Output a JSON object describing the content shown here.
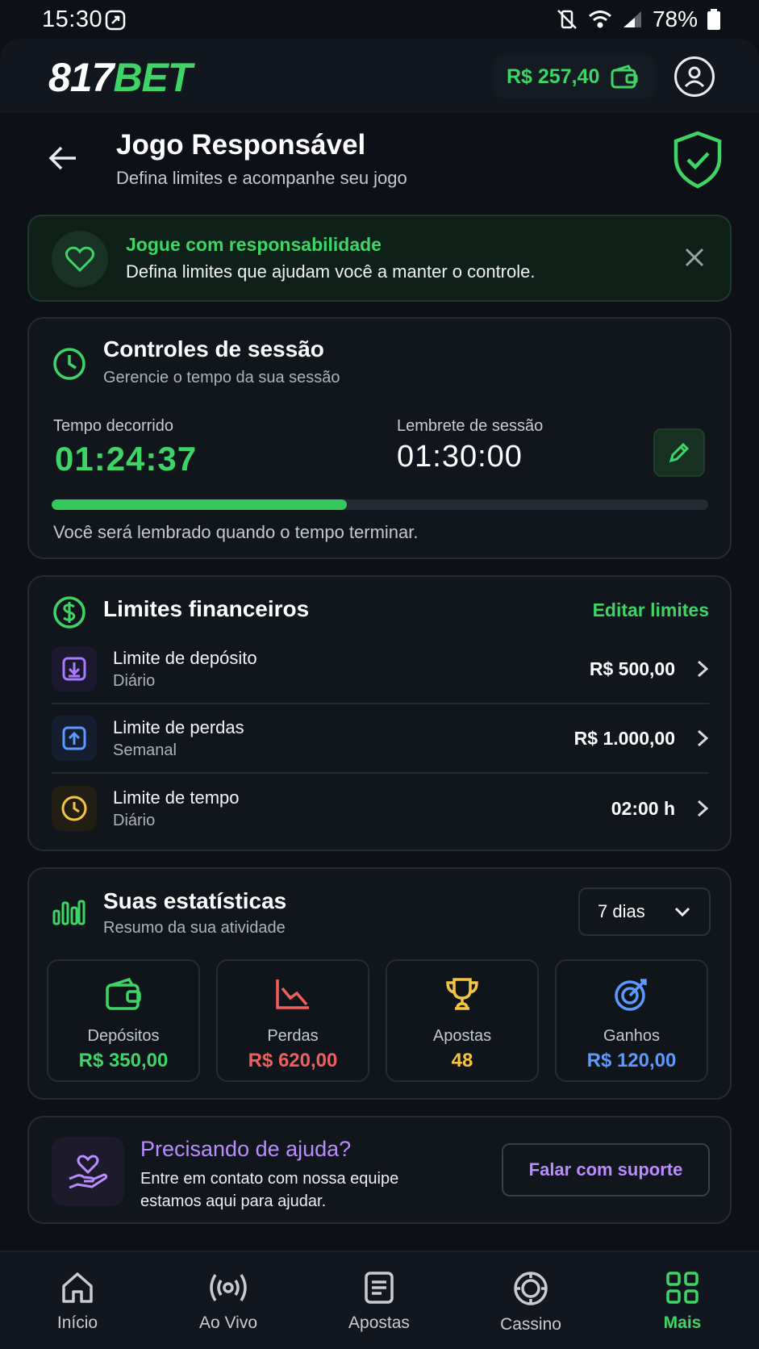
{
  "status_bar": {
    "time": "15:30",
    "battery": "78%"
  },
  "header": {
    "logo_white": "817",
    "logo_green": "BET",
    "balance": "R$ 257,40"
  },
  "page": {
    "title": "Jogo Responsável",
    "subtitle": "Defina limites e acompanhe seu jogo"
  },
  "banner": {
    "title": "Jogue com responsabilidade",
    "text": "Defina limites que ajudam você a manter o controle."
  },
  "session": {
    "title": "Controles de sessão",
    "subtitle": "Gerencie o tempo da sua sessão",
    "elapsed_label": "Tempo decorrido",
    "elapsed_value": "01:24:37",
    "reminder_label": "Lembrete de sessão",
    "reminder_value": "01:30:00",
    "progress": 0.45,
    "note": "Você será lembrado quando o tempo terminar."
  },
  "limits": {
    "title": "Limites financeiros",
    "edit_label": "Editar limites",
    "items": [
      {
        "name": "Limite de depósito",
        "period": "Diário",
        "value": "R$ 500,00",
        "icon": "deposit-icon",
        "color": "#a77bff"
      },
      {
        "name": "Limite de perdas",
        "period": "Semanal",
        "value": "R$ 1.000,00",
        "icon": "upload-icon",
        "color": "#5b9bff"
      },
      {
        "name": "Limite de tempo",
        "period": "Diário",
        "value": "02:00 h",
        "icon": "clock-icon",
        "color": "#f5c542"
      }
    ]
  },
  "stats": {
    "title": "Suas estatísticas",
    "subtitle": "Resumo da sua atividade",
    "range": "7 dias",
    "items": [
      {
        "label": "Depósitos",
        "value": "R$ 350,00",
        "color": "#3ed566",
        "icon": "wallet-icon"
      },
      {
        "label": "Perdas",
        "value": "R$ 620,00",
        "color": "#f0605a",
        "icon": "trend-down-icon"
      },
      {
        "label": "Apostas",
        "value": "48",
        "color": "#f5c542",
        "icon": "trophy-icon"
      },
      {
        "label": "Ganhos",
        "value": "R$ 120,00",
        "color": "#5b9bff",
        "icon": "target-icon"
      }
    ]
  },
  "help": {
    "title": "Precisando de ajuda?",
    "text": "Entre em contato com nossa equipe estamos aqui para ajudar.",
    "button": "Falar com suporte"
  },
  "nav": {
    "items": [
      {
        "label": "Início",
        "icon": "home-icon"
      },
      {
        "label": "Ao Vivo",
        "icon": "live-icon"
      },
      {
        "label": "Apostas",
        "icon": "bets-icon"
      },
      {
        "label": "Cassino",
        "icon": "casino-icon"
      },
      {
        "label": "Mais",
        "icon": "grid-icon",
        "active": true
      }
    ]
  },
  "colors": {
    "accent": "#3ed566",
    "background": "#0d1017",
    "card": "#11151c",
    "help_accent": "#b98cff"
  }
}
